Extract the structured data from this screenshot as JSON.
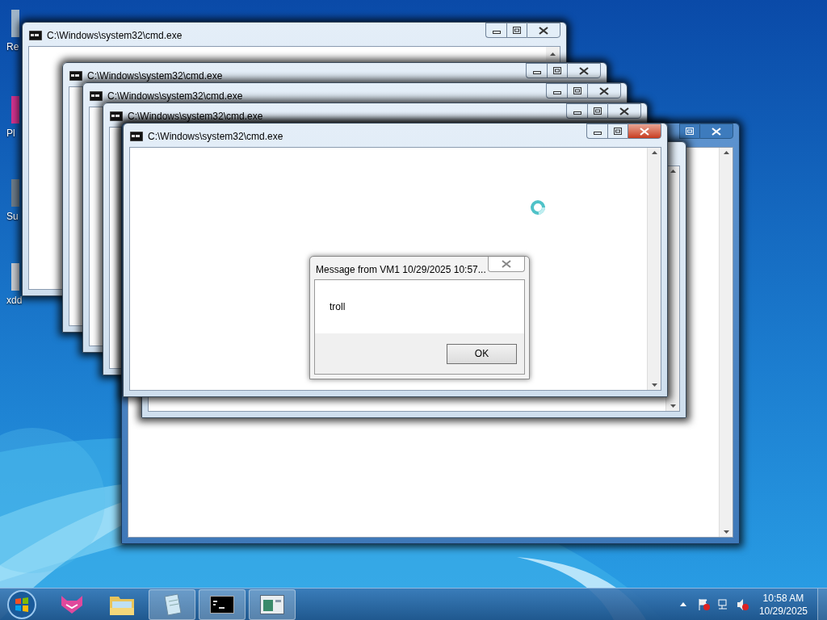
{
  "desktop_icons": [
    {
      "label": "Re"
    },
    {
      "label": "Pl"
    },
    {
      "label": "Su"
    },
    {
      "label": "xdd"
    }
  ],
  "windows": [
    {
      "kind": "cmd",
      "title": "C:\\Windows\\system32\\cmd.exe",
      "active": false
    },
    {
      "kind": "cmd",
      "title": "C:\\Windows\\system32\\cmd.exe",
      "active": false
    },
    {
      "kind": "cmd",
      "title": "C:\\Windows\\system32\\cmd.exe",
      "active": false
    },
    {
      "kind": "cmd",
      "title": "C:\\Windows\\system32\\cmd.exe",
      "active": false
    },
    {
      "kind": "blank",
      "active": true
    },
    {
      "kind": "blank",
      "active": false
    },
    {
      "kind": "cmd",
      "title": "C:\\Windows\\system32\\cmd.exe",
      "active": true
    }
  ],
  "message_box": {
    "title": "Message from VM1 10/29/2025 10:57...",
    "message": "troll",
    "button": "OK"
  },
  "taskbar": {
    "items": [
      {
        "kind": "cat",
        "selected": false
      },
      {
        "kind": "folder",
        "selected": false
      },
      {
        "kind": "notepad",
        "selected": true
      },
      {
        "kind": "cmd",
        "selected": true
      },
      {
        "kind": "app",
        "selected": true
      }
    ],
    "time": "10:58 AM",
    "date": "10/29/2025"
  }
}
